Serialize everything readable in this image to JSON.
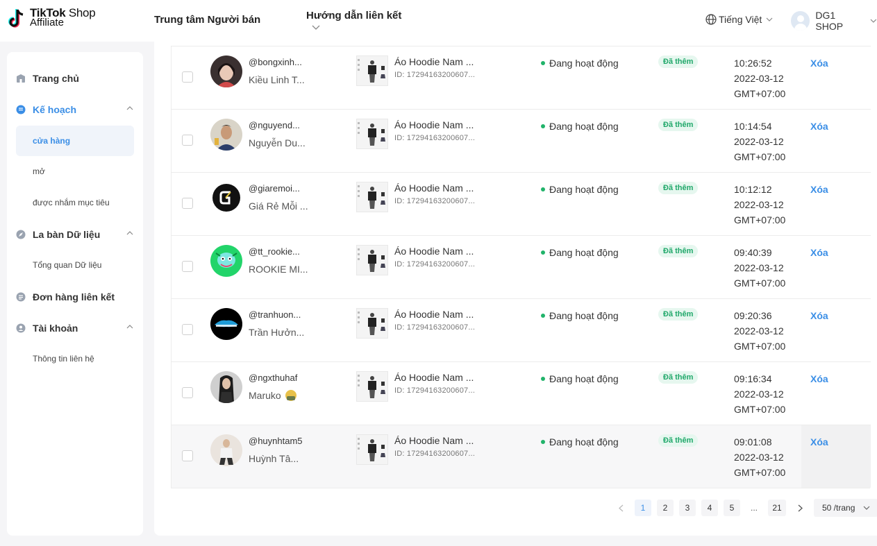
{
  "header": {
    "logo_line1": "TikTok",
    "logo_shop": "Shop",
    "logo_line2": "Affiliate",
    "seller_center": "Trung tâm Người bán",
    "guide": "Hướng dẫn liên kết",
    "language": "Tiếng Việt",
    "shop_name": "DG1 SHOP"
  },
  "sidebar": {
    "home": "Trang chủ",
    "plan": "Kế hoạch",
    "plan_items": [
      "cửa hàng",
      "mở",
      "được nhắm mục tiêu"
    ],
    "compass": "La bàn Dữ liệu",
    "compass_items": [
      "Tổng quan Dữ liệu"
    ],
    "orders": "Đơn hàng liên kết",
    "account": "Tài khoản",
    "account_items": [
      "Thông tin liên hệ"
    ]
  },
  "colors": {
    "accent": "#3a8ee6",
    "status_green": "#21b36a",
    "badge_bg": "#e6f7ef"
  },
  "table": {
    "rows": [
      {
        "handle": "@bongxinh...",
        "name": "Kiều Linh T...",
        "product": "Áo Hoodie Nam ...",
        "product_id": "ID: 17294163200607...",
        "status": "Đang hoạt động",
        "badge": "Đã thêm",
        "time": "10:26:52",
        "date": "2022-03-12",
        "tz": "GMT+07:00",
        "action": "Xóa"
      },
      {
        "handle": "@nguyend...",
        "name": "Nguyễn Du...",
        "product": "Áo Hoodie Nam ...",
        "product_id": "ID: 17294163200607...",
        "status": "Đang hoạt động",
        "badge": "Đã thêm",
        "time": "10:14:54",
        "date": "2022-03-12",
        "tz": "GMT+07:00",
        "action": "Xóa"
      },
      {
        "handle": "@giaremoi...",
        "name": "Giá Rẻ Mỗi ...",
        "product": "Áo Hoodie Nam ...",
        "product_id": "ID: 17294163200607...",
        "status": "Đang hoạt động",
        "badge": "Đã thêm",
        "time": "10:12:12",
        "date": "2022-03-12",
        "tz": "GMT+07:00",
        "action": "Xóa"
      },
      {
        "handle": "@tt_rookie...",
        "name": "ROOKIE MI...",
        "product": "Áo Hoodie Nam ...",
        "product_id": "ID: 17294163200607...",
        "status": "Đang hoạt động",
        "badge": "Đã thêm",
        "time": "09:40:39",
        "date": "2022-03-12",
        "tz": "GMT+07:00",
        "action": "Xóa"
      },
      {
        "handle": "@tranhuon...",
        "name": "Trần Hưởn...",
        "product": "Áo Hoodie Nam ...",
        "product_id": "ID: 17294163200607...",
        "status": "Đang hoạt động",
        "badge": "Đã thêm",
        "time": "09:20:36",
        "date": "2022-03-12",
        "tz": "GMT+07:00",
        "action": "Xóa"
      },
      {
        "handle": "@ngxthuhaf",
        "name": "Maruko",
        "product": "Áo Hoodie Nam ...",
        "product_id": "ID: 17294163200607...",
        "status": "Đang hoạt động",
        "badge": "Đã thêm",
        "time": "09:16:34",
        "date": "2022-03-12",
        "tz": "GMT+07:00",
        "action": "Xóa"
      },
      {
        "handle": "@huynhtam5",
        "name": "Huỳnh Tâ...",
        "product": "Áo Hoodie Nam ...",
        "product_id": "ID: 17294163200607...",
        "status": "Đang hoạt động",
        "badge": "Đã thêm",
        "time": "09:01:08",
        "date": "2022-03-12",
        "tz": "GMT+07:00",
        "action": "Xóa"
      }
    ]
  },
  "pagination": {
    "pages": [
      "1",
      "2",
      "3",
      "4",
      "5"
    ],
    "ellipsis": "...",
    "last": "21",
    "current": "1",
    "page_size": "50 /trang"
  }
}
